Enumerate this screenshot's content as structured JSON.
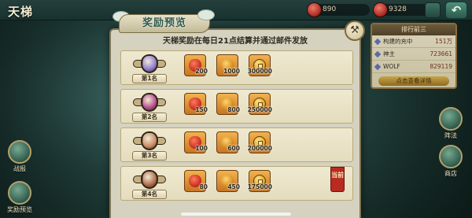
{
  "topbar": {
    "title": "天梯",
    "resources": [
      {
        "icon": "red-gem-icon",
        "value": "890"
      },
      {
        "icon": "red-orb-icon",
        "value": "9328"
      }
    ],
    "back_icon": "back-arrow-icon"
  },
  "side_buttons": {
    "left": [
      {
        "label": "战报",
        "icon": "battle-report-icon"
      },
      {
        "label": "奖励预览",
        "icon": "reward-chest-icon"
      }
    ],
    "right": [
      {
        "label": "阵法",
        "icon": "formation-icon"
      },
      {
        "label": "商店",
        "icon": "shop-icon"
      }
    ]
  },
  "ranking_panel": {
    "header": "排行前三",
    "rows": [
      {
        "name": "构建的充中",
        "power": "151万"
      },
      {
        "name": "神主",
        "power": "723661"
      },
      {
        "name": "WOLF",
        "power": "829119"
      }
    ],
    "footer": "点击查看详情"
  },
  "modal": {
    "banner_title": "奖励预览",
    "close_icon": "hammer-icon",
    "notice": "天梯奖励在每日21点结算并通过邮件发放",
    "current_tag": "当前",
    "rewards": [
      {
        "rank_label": "第1名",
        "medal_color": "#8f7bd0",
        "items": [
          {
            "type": "pouch",
            "count": "200"
          },
          {
            "type": "orb",
            "count": "1000"
          },
          {
            "type": "coin",
            "count": "300000"
          }
        ]
      },
      {
        "rank_label": "第2名",
        "medal_color": "#b74b8d",
        "items": [
          {
            "type": "pouch",
            "count": "150"
          },
          {
            "type": "orb",
            "count": "800"
          },
          {
            "type": "coin",
            "count": "250000"
          }
        ]
      },
      {
        "rank_label": "第3名",
        "medal_color": "#c98a62",
        "items": [
          {
            "type": "pouch",
            "count": "100"
          },
          {
            "type": "orb",
            "count": "600"
          },
          {
            "type": "coin",
            "count": "200000"
          }
        ]
      },
      {
        "rank_label": "第4名",
        "medal_color": "#b06a48",
        "current": true,
        "items": [
          {
            "type": "pouch",
            "count": "80"
          },
          {
            "type": "orb",
            "count": "450"
          },
          {
            "type": "coin",
            "count": "175000"
          }
        ]
      }
    ]
  }
}
